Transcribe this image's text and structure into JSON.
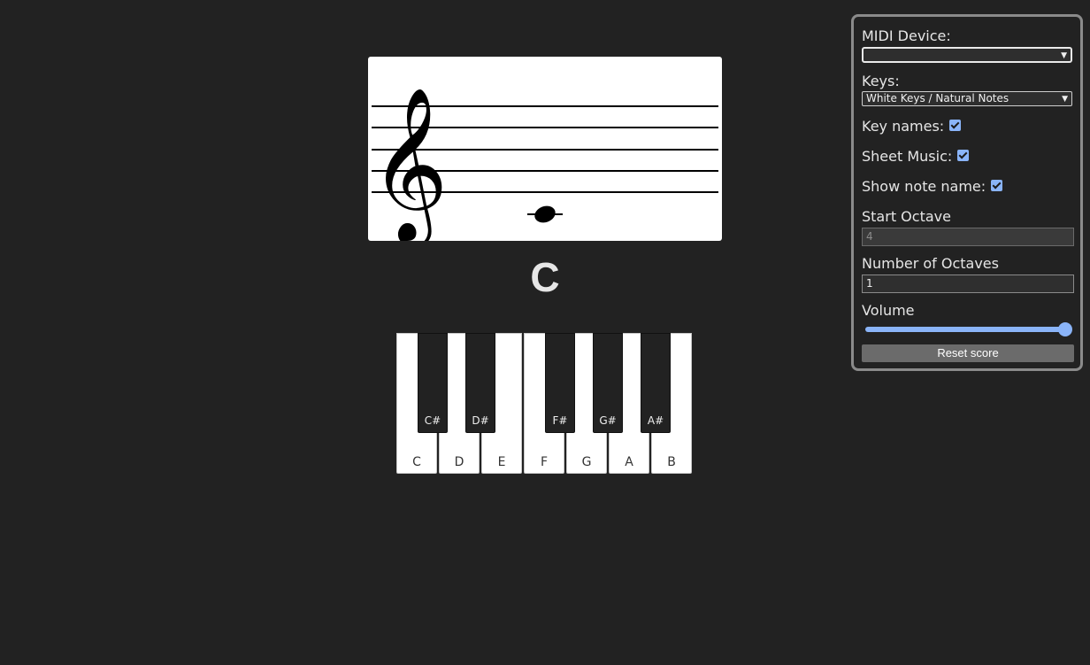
{
  "staff": {
    "clef": "treble-clef-icon",
    "note": "C4 whole note on ledger line"
  },
  "current_note": "C",
  "piano": {
    "white_keys": [
      "C",
      "D",
      "E",
      "F",
      "G",
      "A",
      "B"
    ],
    "black_keys": [
      "C#",
      "D#",
      "F#",
      "G#",
      "A#"
    ]
  },
  "settings": {
    "midi_device_label": "MIDI Device:",
    "midi_device_value": "",
    "keys_label": "Keys:",
    "keys_value": "White Keys / Natural Notes",
    "key_names_label": "Key names:",
    "key_names_checked": true,
    "sheet_music_label": "Sheet Music:",
    "sheet_music_checked": true,
    "show_note_name_label": "Show note name:",
    "show_note_name_checked": true,
    "start_octave_label": "Start Octave",
    "start_octave_value": "4",
    "num_octaves_label": "Number of Octaves",
    "num_octaves_value": "1",
    "volume_label": "Volume",
    "volume_value": 1.0,
    "reset_label": "Reset score"
  },
  "colors": {
    "background": "#222222",
    "accent": "#8ab4f8"
  }
}
